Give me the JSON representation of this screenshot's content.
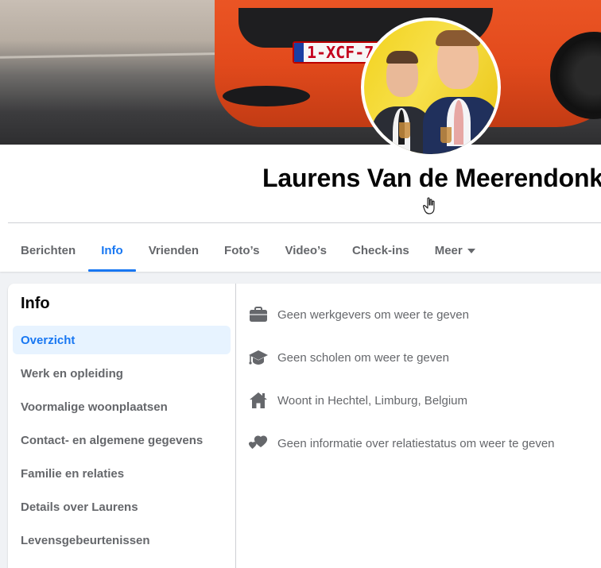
{
  "cover": {
    "license_plate": "1-XCF-7"
  },
  "profile": {
    "name": "Laurens Van de Meerendonk"
  },
  "tabs": [
    {
      "label": "Berichten",
      "active": false
    },
    {
      "label": "Info",
      "active": true
    },
    {
      "label": "Vrienden",
      "active": false
    },
    {
      "label": "Foto’s",
      "active": false
    },
    {
      "label": "Video’s",
      "active": false
    },
    {
      "label": "Check-ins",
      "active": false
    },
    {
      "label": "Meer",
      "active": false,
      "has_dropdown": true
    }
  ],
  "sidebar": {
    "title": "Info",
    "items": [
      {
        "label": "Overzicht",
        "active": true
      },
      {
        "label": "Werk en opleiding"
      },
      {
        "label": "Voormalige woonplaatsen"
      },
      {
        "label": "Contact- en algemene gegevens"
      },
      {
        "label": "Familie en relaties"
      },
      {
        "label": "Details over Laurens"
      },
      {
        "label": "Levensgebeurtenissen"
      }
    ]
  },
  "overview": [
    {
      "icon": "briefcase-icon",
      "text": "Geen werkgevers om weer te geven"
    },
    {
      "icon": "graduation-cap-icon",
      "text": "Geen scholen om weer te geven"
    },
    {
      "icon": "home-icon",
      "text": "Woont in Hechtel, Limburg, Belgium"
    },
    {
      "icon": "heart-icon",
      "text": "Geen informatie over relatiestatus om weer te geven"
    }
  ],
  "colors": {
    "accent": "#1877f2",
    "active_bg": "#e7f3ff",
    "muted_text": "#65676b",
    "icon_gray": "#65676b"
  }
}
